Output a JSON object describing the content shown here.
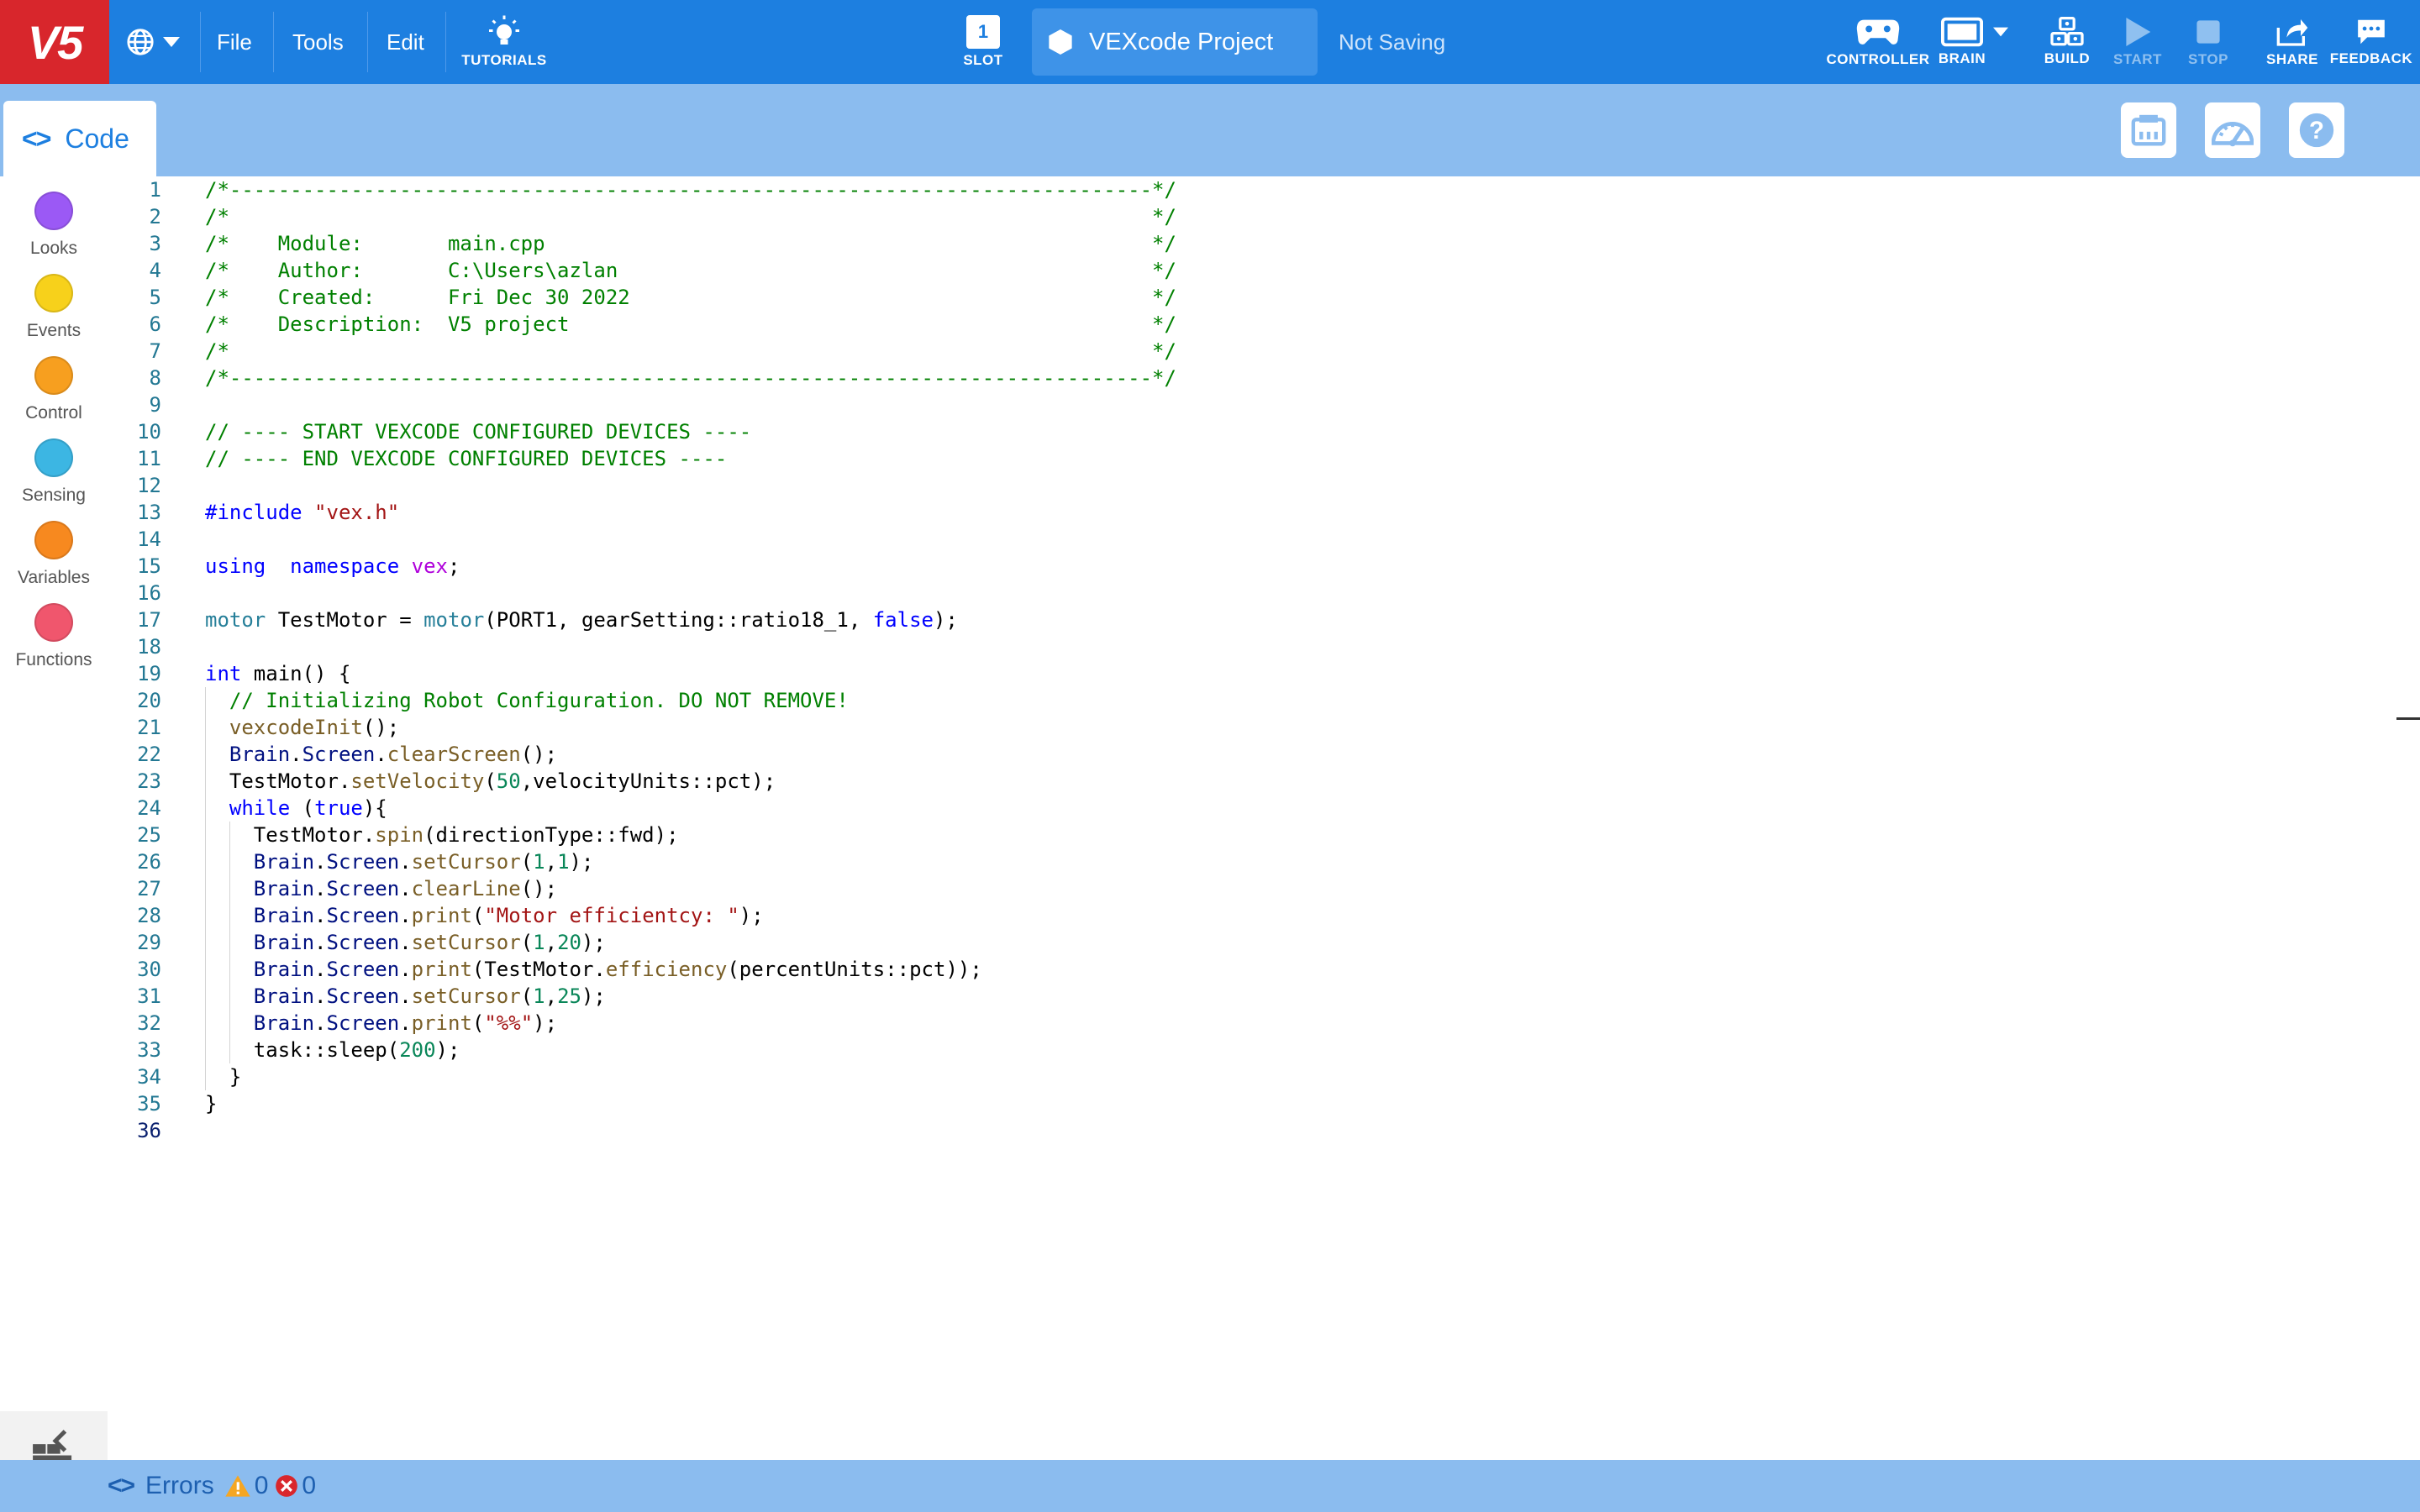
{
  "toolbar": {
    "logo": "V5",
    "menus": [
      "File",
      "Tools",
      "Edit"
    ],
    "tutorials": "TUTORIALS",
    "slot_label": "SLOT",
    "slot_number": "1",
    "project_name": "VEXcode Project",
    "save_status": "Not Saving",
    "controller": "CONTROLLER",
    "brain": "BRAIN",
    "build": "BUILD",
    "start": "START",
    "stop": "STOP",
    "share": "SHARE",
    "feedback": "FEEDBACK"
  },
  "tabs": {
    "code": "Code"
  },
  "categories": [
    {
      "label": "Looks",
      "color": "#9b59f5"
    },
    {
      "label": "Events",
      "color": "#f7d11b"
    },
    {
      "label": "Control",
      "color": "#f79f1f"
    },
    {
      "label": "Sensing",
      "color": "#3cb6e3"
    },
    {
      "label": "Variables",
      "color": "#f7891f"
    },
    {
      "label": "Functions",
      "color": "#f0566d"
    }
  ],
  "editor": {
    "active_line": 36,
    "lines": [
      [
        [
          "c-cmt",
          "/*----------------------------------------------------------------------------*/"
        ]
      ],
      [
        [
          "c-cmt",
          "/*                                                                            */"
        ]
      ],
      [
        [
          "c-cmt",
          "/*    Module:       main.cpp                                                  */"
        ]
      ],
      [
        [
          "c-cmt",
          "/*    Author:       C:\\Users\\azlan                                            */"
        ]
      ],
      [
        [
          "c-cmt",
          "/*    Created:      Fri Dec 30 2022                                           */"
        ]
      ],
      [
        [
          "c-cmt",
          "/*    Description:  V5 project                                                */"
        ]
      ],
      [
        [
          "c-cmt",
          "/*                                                                            */"
        ]
      ],
      [
        [
          "c-cmt",
          "/*----------------------------------------------------------------------------*/"
        ]
      ],
      [],
      [
        [
          "c-cmt",
          "// ---- START VEXCODE CONFIGURED DEVICES ----"
        ]
      ],
      [
        [
          "c-cmt",
          "// ---- END VEXCODE CONFIGURED DEVICES ----"
        ]
      ],
      [],
      [
        [
          "c-pre",
          "#include "
        ],
        [
          "c-str",
          "\"vex.h\""
        ]
      ],
      [],
      [
        [
          "c-kw",
          "using"
        ],
        [
          "",
          "  "
        ],
        [
          "c-kw",
          "namespace"
        ],
        [
          "",
          " "
        ],
        [
          "c-ns",
          "vex"
        ],
        [
          "",
          ";"
        ]
      ],
      [],
      [
        [
          "c-ty",
          "motor"
        ],
        [
          "",
          " TestMotor = "
        ],
        [
          "c-ty",
          "motor"
        ],
        [
          "",
          "(PORT1, gearSetting::ratio18_1, "
        ],
        [
          "c-kw",
          "false"
        ],
        [
          "",
          ");"
        ]
      ],
      [],
      [
        [
          "c-kw",
          "int"
        ],
        [
          "",
          " main() {"
        ]
      ],
      [
        [
          "",
          "  "
        ],
        [
          "c-cmt",
          "// Initializing Robot Configuration. DO NOT REMOVE!"
        ]
      ],
      [
        [
          "",
          "  "
        ],
        [
          "c-fn",
          "vexcodeInit"
        ],
        [
          "",
          "();"
        ]
      ],
      [
        [
          "",
          "  "
        ],
        [
          "c-obj",
          "Brain"
        ],
        [
          "",
          "."
        ],
        [
          "c-obj",
          "Screen"
        ],
        [
          "",
          "."
        ],
        [
          "c-fn",
          "clearScreen"
        ],
        [
          "",
          "();"
        ]
      ],
      [
        [
          "",
          "  TestMotor."
        ],
        [
          "c-fn",
          "setVelocity"
        ],
        [
          "",
          "("
        ],
        [
          "c-num",
          "50"
        ],
        [
          "",
          ",velocityUnits::pct);"
        ]
      ],
      [
        [
          "",
          "  "
        ],
        [
          "c-kw",
          "while"
        ],
        [
          "",
          " ("
        ],
        [
          "c-kw",
          "true"
        ],
        [
          "",
          "){"
        ]
      ],
      [
        [
          "",
          "    TestMotor."
        ],
        [
          "c-fn",
          "spin"
        ],
        [
          "",
          "(directionType::fwd);"
        ]
      ],
      [
        [
          "",
          "    "
        ],
        [
          "c-obj",
          "Brain"
        ],
        [
          "",
          "."
        ],
        [
          "c-obj",
          "Screen"
        ],
        [
          "",
          "."
        ],
        [
          "c-fn",
          "setCursor"
        ],
        [
          "",
          "("
        ],
        [
          "c-num",
          "1"
        ],
        [
          "",
          ","
        ],
        [
          "c-num",
          "1"
        ],
        [
          "",
          ");"
        ]
      ],
      [
        [
          "",
          "    "
        ],
        [
          "c-obj",
          "Brain"
        ],
        [
          "",
          "."
        ],
        [
          "c-obj",
          "Screen"
        ],
        [
          "",
          "."
        ],
        [
          "c-fn",
          "clearLine"
        ],
        [
          "",
          "();"
        ]
      ],
      [
        [
          "",
          "    "
        ],
        [
          "c-obj",
          "Brain"
        ],
        [
          "",
          "."
        ],
        [
          "c-obj",
          "Screen"
        ],
        [
          "",
          "."
        ],
        [
          "c-fn",
          "print"
        ],
        [
          "",
          "("
        ],
        [
          "c-str",
          "\"Motor efficientcy: \""
        ],
        [
          "",
          ");"
        ]
      ],
      [
        [
          "",
          "    "
        ],
        [
          "c-obj",
          "Brain"
        ],
        [
          "",
          "."
        ],
        [
          "c-obj",
          "Screen"
        ],
        [
          "",
          "."
        ],
        [
          "c-fn",
          "setCursor"
        ],
        [
          "",
          "("
        ],
        [
          "c-num",
          "1"
        ],
        [
          "",
          ","
        ],
        [
          "c-num",
          "20"
        ],
        [
          "",
          ");"
        ]
      ],
      [
        [
          "",
          "    "
        ],
        [
          "c-obj",
          "Brain"
        ],
        [
          "",
          "."
        ],
        [
          "c-obj",
          "Screen"
        ],
        [
          "",
          "."
        ],
        [
          "c-fn",
          "print"
        ],
        [
          "",
          "(TestMotor."
        ],
        [
          "c-fn",
          "efficiency"
        ],
        [
          "",
          "(percentUnits::pct));"
        ]
      ],
      [
        [
          "",
          "    "
        ],
        [
          "c-obj",
          "Brain"
        ],
        [
          "",
          "."
        ],
        [
          "c-obj",
          "Screen"
        ],
        [
          "",
          "."
        ],
        [
          "c-fn",
          "setCursor"
        ],
        [
          "",
          "("
        ],
        [
          "c-num",
          "1"
        ],
        [
          "",
          ","
        ],
        [
          "c-num",
          "25"
        ],
        [
          "",
          ");"
        ]
      ],
      [
        [
          "",
          "    "
        ],
        [
          "c-obj",
          "Brain"
        ],
        [
          "",
          "."
        ],
        [
          "c-obj",
          "Screen"
        ],
        [
          "",
          "."
        ],
        [
          "c-fn",
          "print"
        ],
        [
          "",
          "("
        ],
        [
          "c-str",
          "\"%%\""
        ],
        [
          "",
          ");"
        ]
      ],
      [
        [
          "",
          "    task::sleep("
        ],
        [
          "c-num",
          "200"
        ],
        [
          "",
          ");"
        ]
      ],
      [
        [
          "",
          "  }"
        ]
      ],
      [
        [
          "",
          "}"
        ]
      ],
      []
    ]
  },
  "statusbar": {
    "errors_label": "Errors",
    "warning_count": "0",
    "error_count": "0"
  }
}
